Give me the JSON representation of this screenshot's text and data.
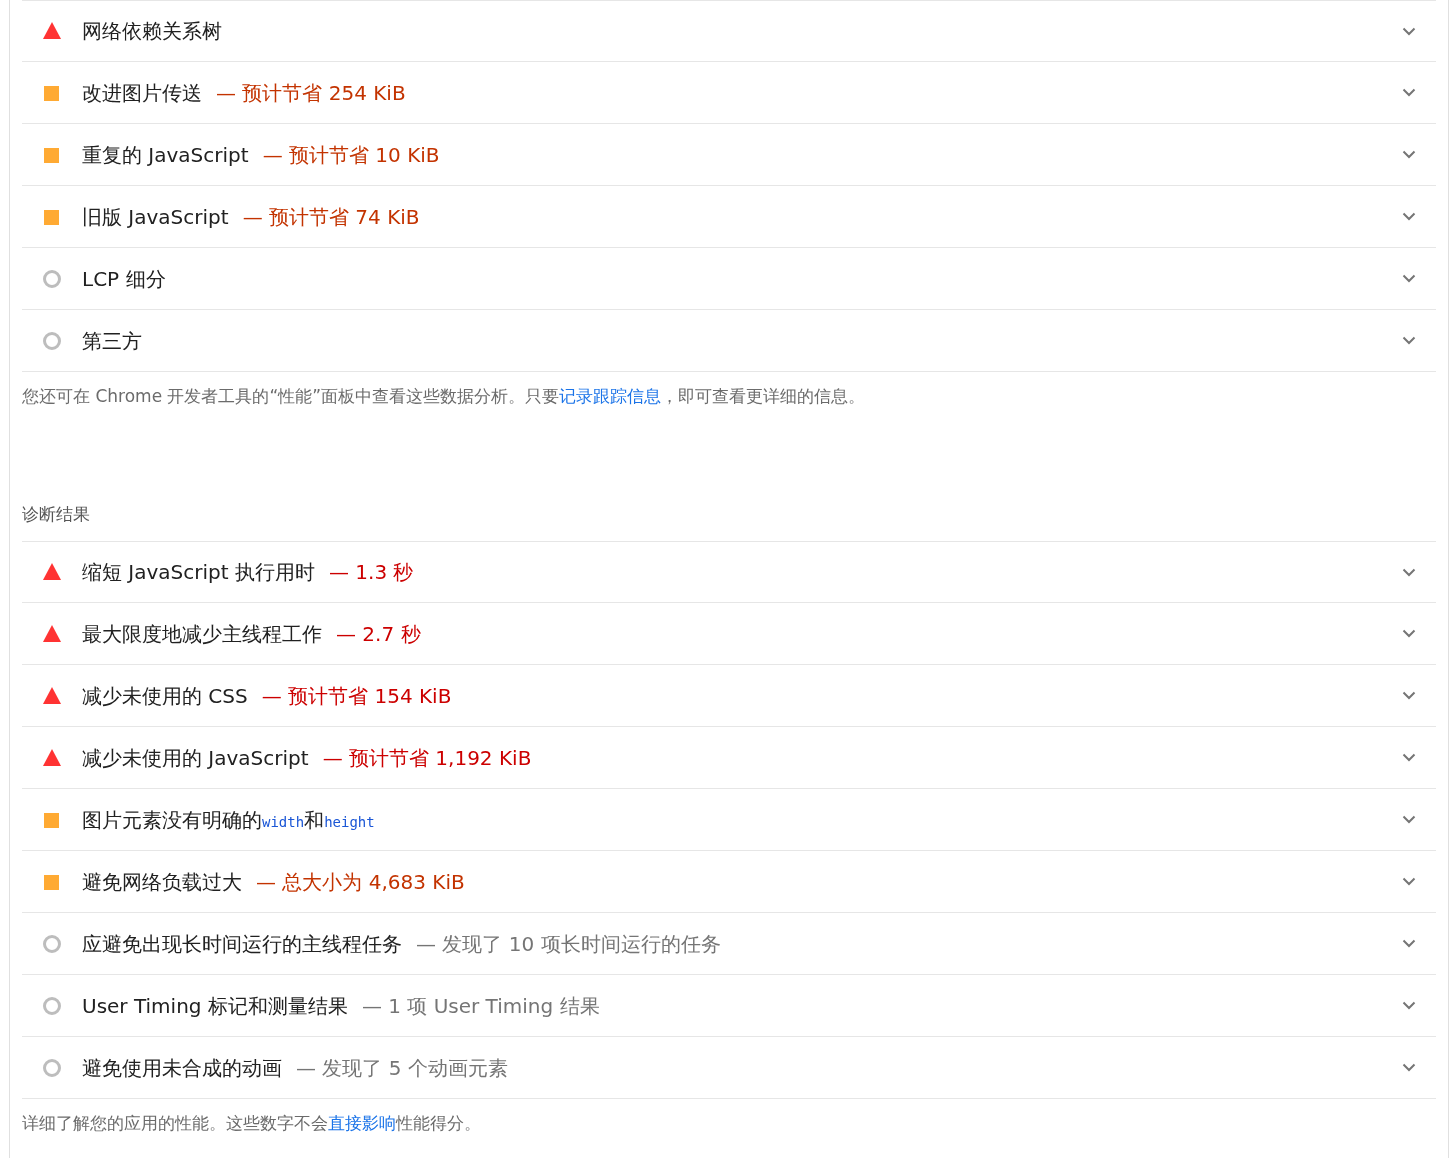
{
  "sections": [
    {
      "audits": [
        {
          "kind": "fail",
          "title": [
            {
              "kind": "text",
              "text": "网络依赖关系树"
            }
          ]
        },
        {
          "kind": "average",
          "title": [
            {
              "kind": "text",
              "text": "改进图片传送"
            }
          ],
          "display_value": "— 预计节省 254 KiB"
        },
        {
          "kind": "average",
          "title": [
            {
              "kind": "text",
              "text": "重复的 JavaScript"
            }
          ],
          "display_value": "— 预计节省 10 KiB"
        },
        {
          "kind": "average",
          "title": [
            {
              "kind": "text",
              "text": "旧版 JavaScript"
            }
          ],
          "display_value": "— 预计节省 74 KiB"
        },
        {
          "kind": "info",
          "title": [
            {
              "kind": "text",
              "text": "LCP 细分"
            }
          ]
        },
        {
          "kind": "info",
          "title": [
            {
              "kind": "text",
              "text": "第三方"
            }
          ]
        }
      ],
      "footnote": [
        {
          "kind": "text",
          "text": "您还可在 Chrome 开发者工具的“性能”面板中查看这些数据分析。只要"
        },
        {
          "kind": "link",
          "text": "记录跟踪信息"
        },
        {
          "kind": "text",
          "text": "，即可查看更详细的信息。"
        }
      ]
    },
    {
      "heading": "诊断结果",
      "audits": [
        {
          "kind": "fail",
          "title": [
            {
              "kind": "text",
              "text": "缩短 JavaScript 执行用时"
            }
          ],
          "display_value": "— 1.3 秒"
        },
        {
          "kind": "fail",
          "title": [
            {
              "kind": "text",
              "text": "最大限度地减少主线程工作"
            }
          ],
          "display_value": "— 2.7 秒"
        },
        {
          "kind": "fail",
          "title": [
            {
              "kind": "text",
              "text": "减少未使用的 CSS"
            }
          ],
          "display_value": "— 预计节省 154 KiB"
        },
        {
          "kind": "fail",
          "title": [
            {
              "kind": "text",
              "text": "减少未使用的 JavaScript"
            }
          ],
          "display_value": "— 预计节省 1,192 KiB"
        },
        {
          "kind": "average",
          "title": [
            {
              "kind": "text",
              "text": "图片元素没有明确的"
            },
            {
              "kind": "code",
              "text": "width"
            },
            {
              "kind": "text",
              "text": "和"
            },
            {
              "kind": "code",
              "text": "height"
            }
          ]
        },
        {
          "kind": "average",
          "title": [
            {
              "kind": "text",
              "text": "避免网络负载过大"
            }
          ],
          "display_value": "— 总大小为 4,683 KiB"
        },
        {
          "kind": "info",
          "title": [
            {
              "kind": "text",
              "text": "应避免出现长时间运行的主线程任务"
            }
          ],
          "display_value": "— 发现了 10 项长时间运行的任务"
        },
        {
          "kind": "info",
          "title": [
            {
              "kind": "text",
              "text": "User Timing 标记和测量结果"
            }
          ],
          "display_value": "— 1 项 User Timing 结果"
        },
        {
          "kind": "info",
          "title": [
            {
              "kind": "text",
              "text": "避免使用未合成的动画"
            }
          ],
          "display_value": "— 发现了 5 个动画元素"
        }
      ],
      "footnote": [
        {
          "kind": "text",
          "text": "详细了解您的应用的性能。这些数字不会"
        },
        {
          "kind": "link",
          "text": "直接影响"
        },
        {
          "kind": "text",
          "text": "性能得分。"
        }
      ]
    }
  ]
}
